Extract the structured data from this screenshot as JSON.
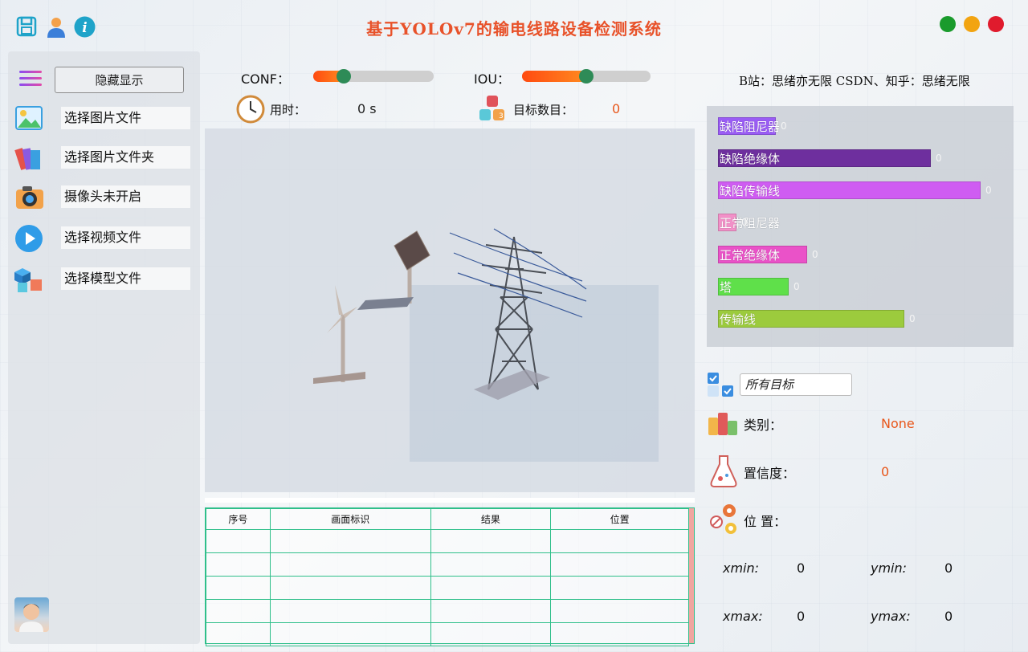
{
  "window": {
    "title": "基于YOLOv7的输电线路设备检测系统",
    "icons": [
      "save-icon",
      "user-icon",
      "info-icon"
    ],
    "controls": {
      "close_color": "#e01b2d",
      "min_color": "#f2a411",
      "max_color": "#1a9b2c"
    }
  },
  "sidebar": {
    "toggle_label": "隐藏显示",
    "items": [
      {
        "label": "选择图片文件",
        "icon": "image-icon"
      },
      {
        "label": "选择图片文件夹",
        "icon": "folder-icon"
      },
      {
        "label": "摄像头未开启",
        "icon": "camera-icon"
      },
      {
        "label": "选择视频文件",
        "icon": "play-icon"
      },
      {
        "label": "选择模型文件",
        "icon": "cube-icon"
      }
    ]
  },
  "controls": {
    "conf_label": "CONF：",
    "conf_value": 0.25,
    "iou_label": "IOU：",
    "iou_value": 0.5,
    "time_label": "用时：",
    "time_value": "0 s",
    "count_label": "目标数目：",
    "count_value": "0"
  },
  "table": {
    "headers": [
      "序号",
      "画面标识",
      "结果",
      "位置"
    ],
    "rows": [
      [
        "",
        "",
        "",
        ""
      ],
      [
        "",
        "",
        "",
        ""
      ],
      [
        "",
        "",
        "",
        ""
      ],
      [
        "",
        "",
        "",
        ""
      ],
      [
        "",
        "",
        "",
        ""
      ]
    ]
  },
  "credit": "B站：思绪亦无限  CSDN、知乎：思绪无限",
  "class_stats": [
    {
      "label": "缺陷阻尼器",
      "value": "0",
      "ratio": 0.22,
      "color": "#9a5cf5"
    },
    {
      "label": "缺陷绝缘体",
      "value": "0",
      "ratio": 0.81,
      "color": "#6e2f9e"
    },
    {
      "label": "缺陷传输线",
      "value": "0",
      "ratio": 1.0,
      "color": "#cf5cf2"
    },
    {
      "label": "正常阻尼器",
      "value": "0",
      "ratio": 0.07,
      "color": "#f290c8"
    },
    {
      "label": "正常绝缘体",
      "value": "0",
      "ratio": 0.34,
      "color": "#ea52c8"
    },
    {
      "label": "塔",
      "value": "0",
      "ratio": 0.27,
      "color": "#5fe04a"
    },
    {
      "label": "传输线",
      "value": "0",
      "ratio": 0.71,
      "color": "#9ccb3d"
    }
  ],
  "detail": {
    "target_select": "所有目标",
    "class_label": "类别：",
    "class_value": "None",
    "conf_label": "置信度：",
    "conf_value": "0",
    "pos_label": "位 置：",
    "xmin_label": "xmin:",
    "xmin_value": "0",
    "ymin_label": "ymin:",
    "ymin_value": "0",
    "xmax_label": "xmax:",
    "xmax_value": "0",
    "ymax_label": "ymax:",
    "ymax_value": "0"
  }
}
